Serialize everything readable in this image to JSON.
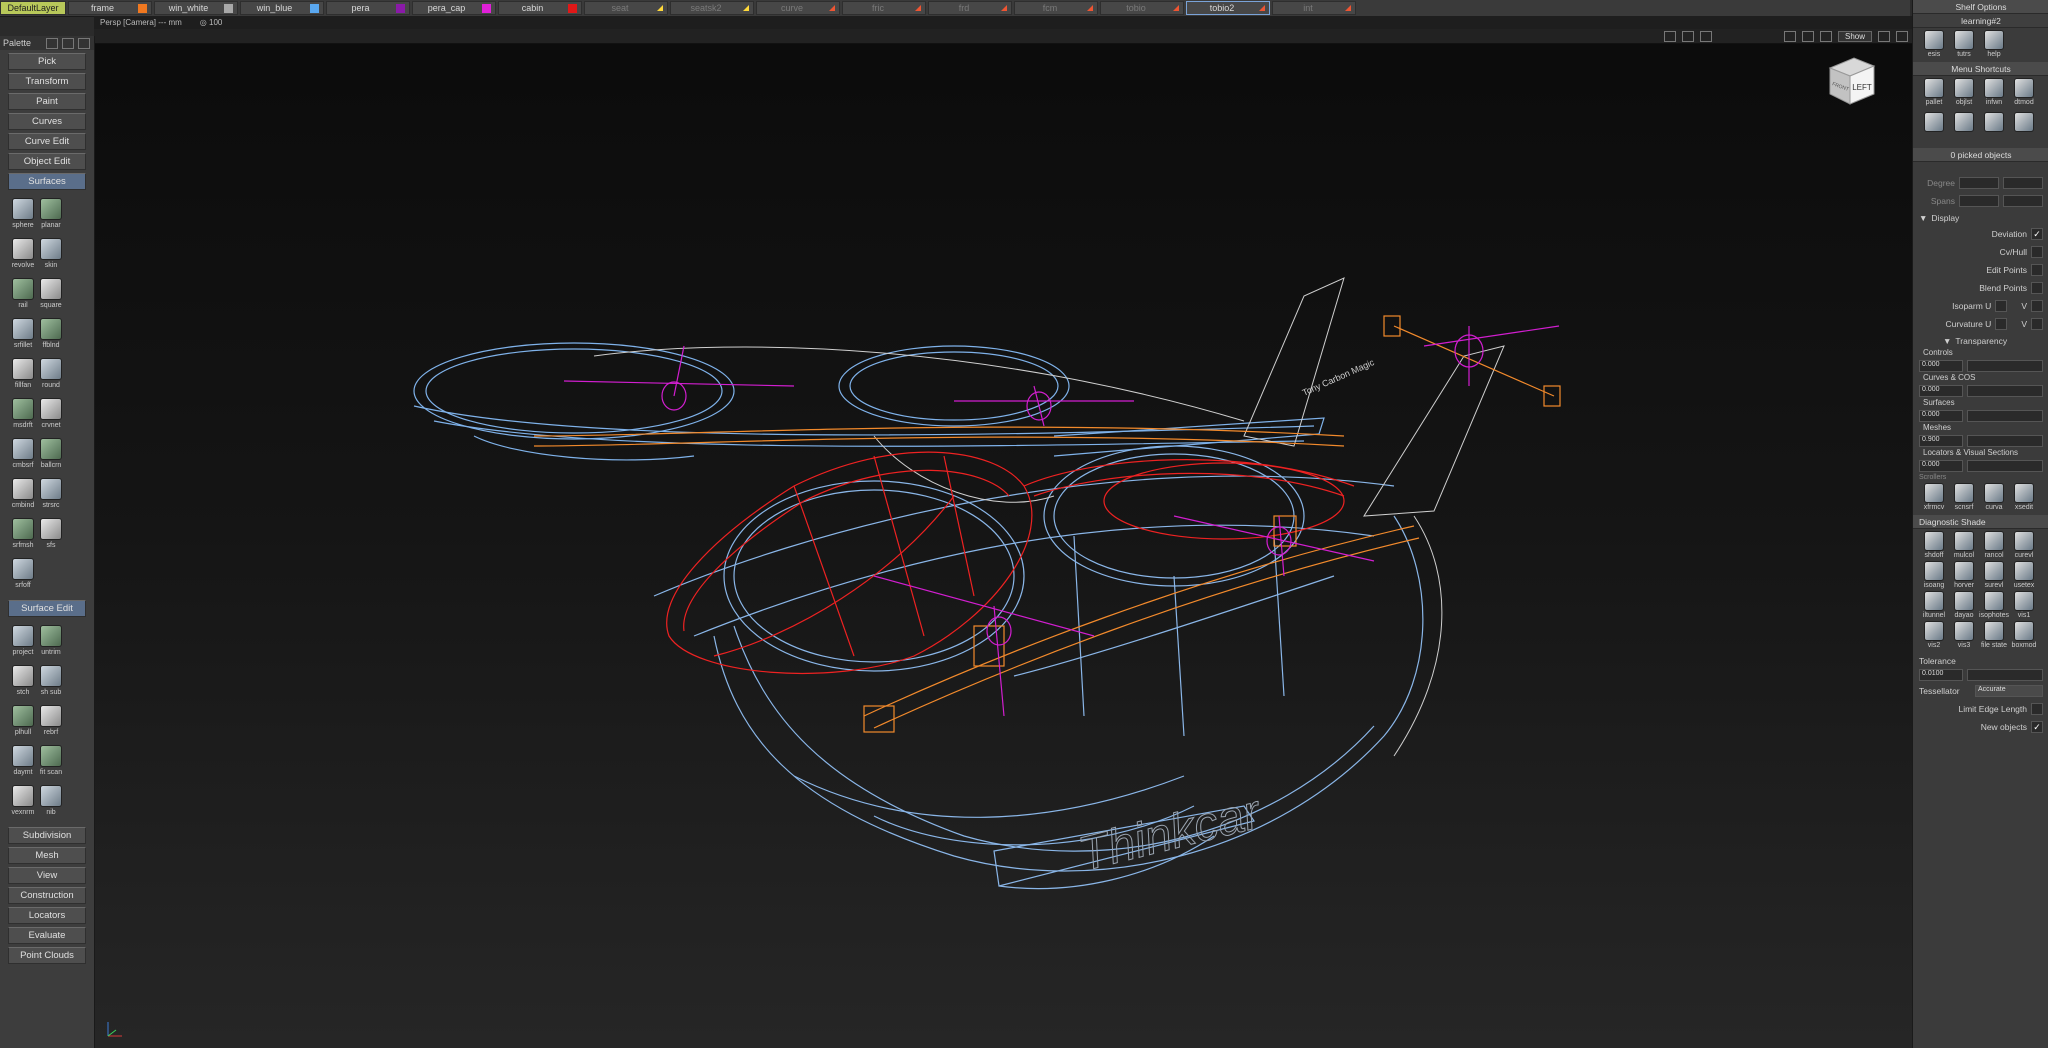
{
  "layer_bar": {
    "layers": [
      {
        "name": "DefaultLayer",
        "style": "default"
      },
      {
        "name": "frame",
        "color": "#f07820"
      },
      {
        "name": "win_white",
        "color": "#a8a8a8"
      },
      {
        "name": "win_blue",
        "color": "#5aa8f0"
      },
      {
        "name": "pera",
        "color": "#8a1aa8"
      },
      {
        "name": "pera_cap",
        "color": "#e020d8"
      },
      {
        "name": "cabin",
        "color": "#e01818"
      },
      {
        "name": "seat",
        "style": "dim",
        "flag": "#ffd93a"
      },
      {
        "name": "seatsk2",
        "style": "dim",
        "flag": "#ffd93a"
      },
      {
        "name": "curve",
        "style": "dim",
        "flag": "#e53"
      },
      {
        "name": "fric",
        "style": "dim",
        "flag": "#e53"
      },
      {
        "name": "frd",
        "style": "dim",
        "flag": "#e53"
      },
      {
        "name": "fcm",
        "style": "dim",
        "flag": "#e53"
      },
      {
        "name": "tobio",
        "style": "dim",
        "flag": "#e53"
      },
      {
        "name": "tobio2",
        "style": "sel",
        "flag": "#e53"
      },
      {
        "name": "int",
        "style": "dim",
        "flag": "#e53"
      }
    ]
  },
  "viewport": {
    "camera": "Persp [Camera] --- mm",
    "zoom": "100",
    "show_label": "Show",
    "viewcube_face": "LEFT",
    "viewcube_side": "FRONT"
  },
  "palette": {
    "title": "Palette",
    "menus_top": [
      "Pick",
      "Transform",
      "Paint",
      "Curves",
      "Curve Edit",
      "Object Edit"
    ],
    "surfaces_label": "Surfaces",
    "surfaces": [
      "sphere",
      "planar",
      "revolve",
      "skin",
      "rail",
      "square",
      "srfillet",
      "ffblnd",
      "fillfan",
      "round",
      "msdrft",
      "crvnet",
      "cmbsrf",
      "ballcrn",
      "cmbind",
      "strsrc",
      "srfmsh",
      "sfs",
      "srfoff"
    ],
    "surface_edit_label": "Surface Edit",
    "surface_edit": [
      "project",
      "untrim",
      "stch",
      "sh sub",
      "plhull",
      "rebrf",
      "daymt",
      "fit scan",
      "vexnrm",
      "nib"
    ],
    "menus_bottom": [
      "Subdivision",
      "Mesh",
      "View",
      "Construction",
      "Locators",
      "Evaluate",
      "Point Clouds"
    ]
  },
  "right_panel": {
    "shelf_options": "Shelf Options",
    "learning": "learning#2",
    "learn_icons": [
      "esis",
      "tutrs",
      "help"
    ],
    "menu_shortcuts": "Menu Shortcuts",
    "shortcut_icons": [
      "pallet",
      "objlst",
      "infwn",
      "dtmod"
    ],
    "picked": "0 picked objects",
    "degree_label": "Degree",
    "spans_label": "Spans",
    "display_label": "Display",
    "display_rows": [
      {
        "label": "Deviation",
        "checked": true
      },
      {
        "label": "Cv/Hull",
        "checked": false
      },
      {
        "label": "Edit Points",
        "checked": false
      },
      {
        "label": "Blend Points",
        "checked": false
      },
      {
        "label": "Isoparm U",
        "checked": false,
        "extra": "V"
      },
      {
        "label": "Curvature U",
        "checked": false,
        "extra": "V"
      }
    ],
    "transparency_label": "Transparency",
    "transparency": [
      {
        "label": "Controls",
        "value": "0.000"
      },
      {
        "label": "Curves & COS",
        "value": "0.000"
      },
      {
        "label": "Surfaces",
        "value": "0.000"
      },
      {
        "label": "Meshes",
        "value": "0.900"
      },
      {
        "label": "Locators & Visual Sections",
        "value": "0.000"
      }
    ],
    "cut_label": "Scrollers",
    "misc_icons": [
      "xfrmcv",
      "scnsrf",
      "curva",
      "xsedit"
    ],
    "diagnostic_label": "Diagnostic Shade",
    "diagnostic_icons": [
      "shdoff",
      "mulcol",
      "rancol",
      "curevl",
      "isoang",
      "horver",
      "surevl",
      "usetex",
      "iltunnel",
      "dayao",
      "isophotes",
      "vis1",
      "vis2",
      "vis3",
      "file state",
      "boxmod"
    ],
    "tolerance_label": "Tolerance",
    "tolerance_value": "0.0100",
    "tessellator_label": "Tessellator",
    "tessellator_value": "Accurate",
    "limit_edge_label": "Limit Edge Length",
    "new_objects_label": "New objects",
    "new_objects_checked": true
  },
  "model": {
    "logo_text": "Thinkcar",
    "tail_text": "Tony Carbon Magic"
  }
}
